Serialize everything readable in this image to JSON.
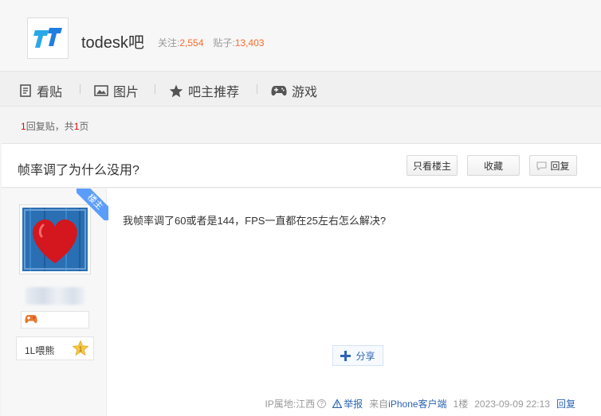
{
  "header": {
    "forum_name": "todesk吧",
    "follow_label": "关注:",
    "follow_count": "2,554",
    "posts_label": "贴子:",
    "posts_count": "13,403"
  },
  "nav": {
    "items": [
      {
        "label": "看贴",
        "icon": "document-icon"
      },
      {
        "label": "图片",
        "icon": "image-icon"
      },
      {
        "label": "吧主推荐",
        "icon": "star-icon"
      },
      {
        "label": "游戏",
        "icon": "gamepad-icon"
      }
    ]
  },
  "reply_info": {
    "count": "1",
    "text_a": "回复贴，共",
    "pages": "1",
    "text_b": "页"
  },
  "thread": {
    "title": "帧率调了为什么没用?",
    "only_op_label": "只看楼主",
    "favorite_label": "收藏",
    "reply_label": "回复"
  },
  "post": {
    "ribbon": "楼主",
    "level_text": "1L喂熊",
    "level_num": "1",
    "content": "我帧率调了60或者是144，FPS一直都在25左右怎么解决?",
    "share_label": "分享",
    "ip_location": "IP属地:江西",
    "report_label": "举报",
    "from_prefix": "来自",
    "client": "iPhone客户端",
    "floor": "1楼",
    "datetime": "2023-09-09 22:13",
    "reply_label": "回复"
  },
  "colors": {
    "accent_orange": "#fa6a2b",
    "link_blue": "#2d64b3",
    "ribbon_blue": "#5b9dfd",
    "red": "#e10602"
  }
}
